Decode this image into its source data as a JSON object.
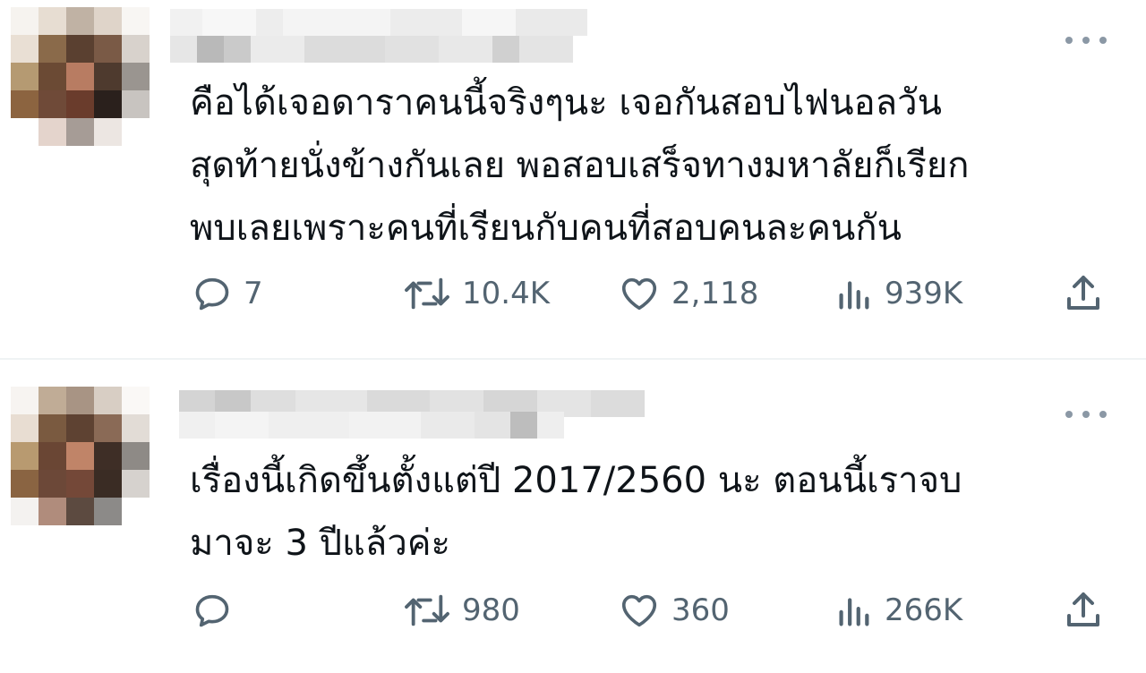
{
  "tweets": [
    {
      "text": "คือได้เจอดาราคนนี้จริงๆนะ เจอกันสอบไฟนอลวัน\nสุดท้ายนั่งข้างกันเลย พอสอบเสร็จทางมหาลัยก็เรียก\nพบเลยเพราะคนที่เรียนกับคนที่สอบคนละคนกัน",
      "replies": "7",
      "retweets": "10.4K",
      "likes": "2,118",
      "views": "939K"
    },
    {
      "text": "เรื่องนี้เกิดขึ้นตั้งแต่ปี 2017/2560 นะ ตอนนี้เราจบ\nมาจะ 3 ปีแล้วค่ะ",
      "replies": "",
      "retweets": "980",
      "likes": "360",
      "views": "266K"
    }
  ],
  "icons": {
    "reply": "reply-icon",
    "retweet": "retweet-icon",
    "like": "heart-icon",
    "views": "views-icon",
    "share": "share-icon",
    "more": "more-icon"
  },
  "colors": {
    "text": "#0f1419",
    "secondary": "#536471",
    "divider": "#eff3f4"
  }
}
